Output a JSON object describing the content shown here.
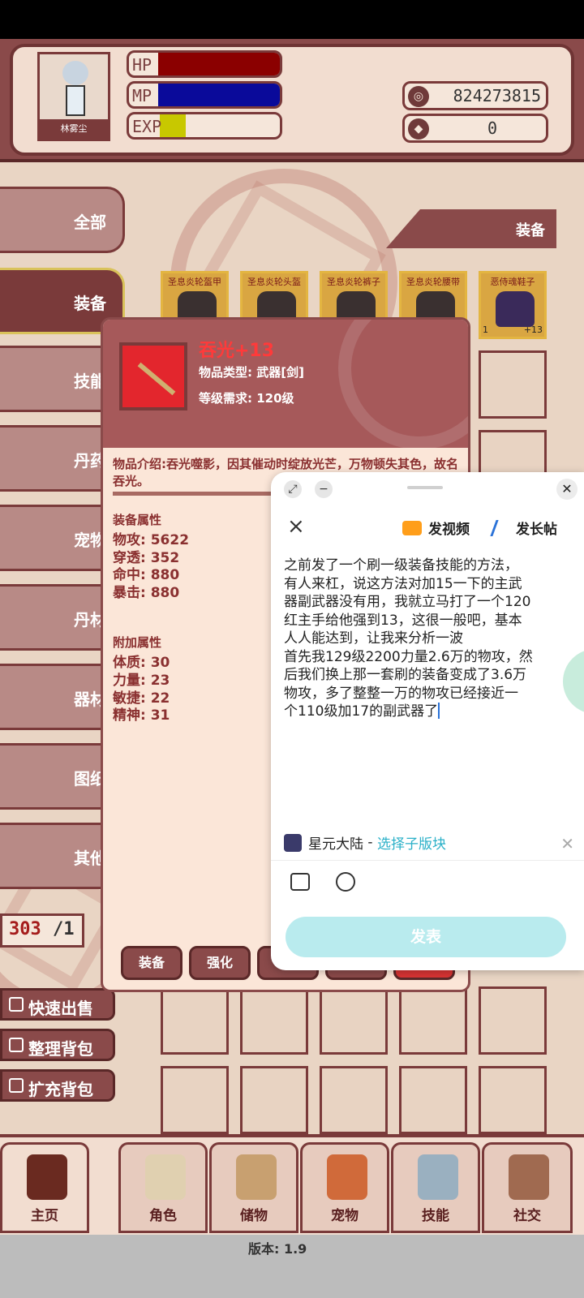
{
  "header": {
    "player_name": "林雾尘",
    "hp_label": "HP",
    "hp_fill": 1.0,
    "mp_label": "MP",
    "mp_fill": 1.0,
    "exp_label": "EXP",
    "exp_fill": 0.2,
    "gold": "824273815",
    "gems": "0"
  },
  "categories": [
    {
      "label": "全部"
    },
    {
      "label": "装备"
    },
    {
      "label": "技能"
    },
    {
      "label": "丹药"
    },
    {
      "label": "宠物"
    },
    {
      "label": "丹材"
    },
    {
      "label": "器材"
    },
    {
      "label": "图纸"
    },
    {
      "label": "其他"
    }
  ],
  "section_label": "装备",
  "items": [
    {
      "name": "圣息炎轮盔甲"
    },
    {
      "name": "圣息炎轮头盔"
    },
    {
      "name": "圣息炎轮裤子"
    },
    {
      "name": "圣息炎轮腰带"
    },
    {
      "name": "恶侍魂鞋子",
      "level": "1",
      "plus": "+13"
    }
  ],
  "bag_count": {
    "used": "303",
    "slash": "/1"
  },
  "side_buttons": {
    "quick_sell": "快速出售",
    "sort_bag": "整理背包",
    "expand_bag": "扩充背包"
  },
  "detail": {
    "item_name": "吞光+13",
    "type_line": "物品类型: 武器[剑]",
    "level_line": "等级需求: 120级",
    "description": "物品介绍:吞光噬影，因其催动时绽放光芒，万物顿失其色，故名吞光。",
    "equip_attr_title": "装备属性",
    "equip_attrs": [
      {
        "k": "物攻: ",
        "v": "5622"
      },
      {
        "k": "穿透: ",
        "v": "352"
      },
      {
        "k": "命中: ",
        "v": "880"
      },
      {
        "k": "暴击: ",
        "v": "880"
      }
    ],
    "extra_attr_title": "附加属性",
    "extra_attrs": [
      {
        "k": "体质: ",
        "v": "30"
      },
      {
        "k": "力量: ",
        "v": "23"
      },
      {
        "k": "敏捷: ",
        "v": "22"
      },
      {
        "k": "精神: ",
        "v": "31"
      }
    ],
    "btn_equip": "装备",
    "btn_enhance": "强化"
  },
  "composer": {
    "video_label": "发视频",
    "longpost_label": "发长帖",
    "lines": [
      "之前发了一个刷一级装备技能的方法，",
      "有人来杠，说这方法对加15一下的主武",
      "器副武器没有用，我就立马打了一个120",
      "红主手给他强到13，这很一般吧，基本",
      "人人能达到，让我来分析一波",
      "首先我129级2200力量2.6万的物攻，然",
      "后我们换上那一套刷的装备变成了3.6万",
      "物攻，多了整整一万的物攻已经接近一",
      "个110级加17的副武器了"
    ],
    "forum_name": "星元大陆",
    "forum_sep": " - ",
    "forum_select": "选择子版块",
    "post_label": "发表"
  },
  "nav": [
    {
      "label": "主页"
    },
    {
      "label": "角色"
    },
    {
      "label": "储物"
    },
    {
      "label": "宠物"
    },
    {
      "label": "技能"
    },
    {
      "label": "社交"
    }
  ],
  "version": "版本: 1.9",
  "colors": {
    "accent": "#7a3a3a",
    "hp": "#8b0000",
    "mp": "#0a0a9a",
    "exp": "#c8c800",
    "post_button": "#b9ebee"
  }
}
